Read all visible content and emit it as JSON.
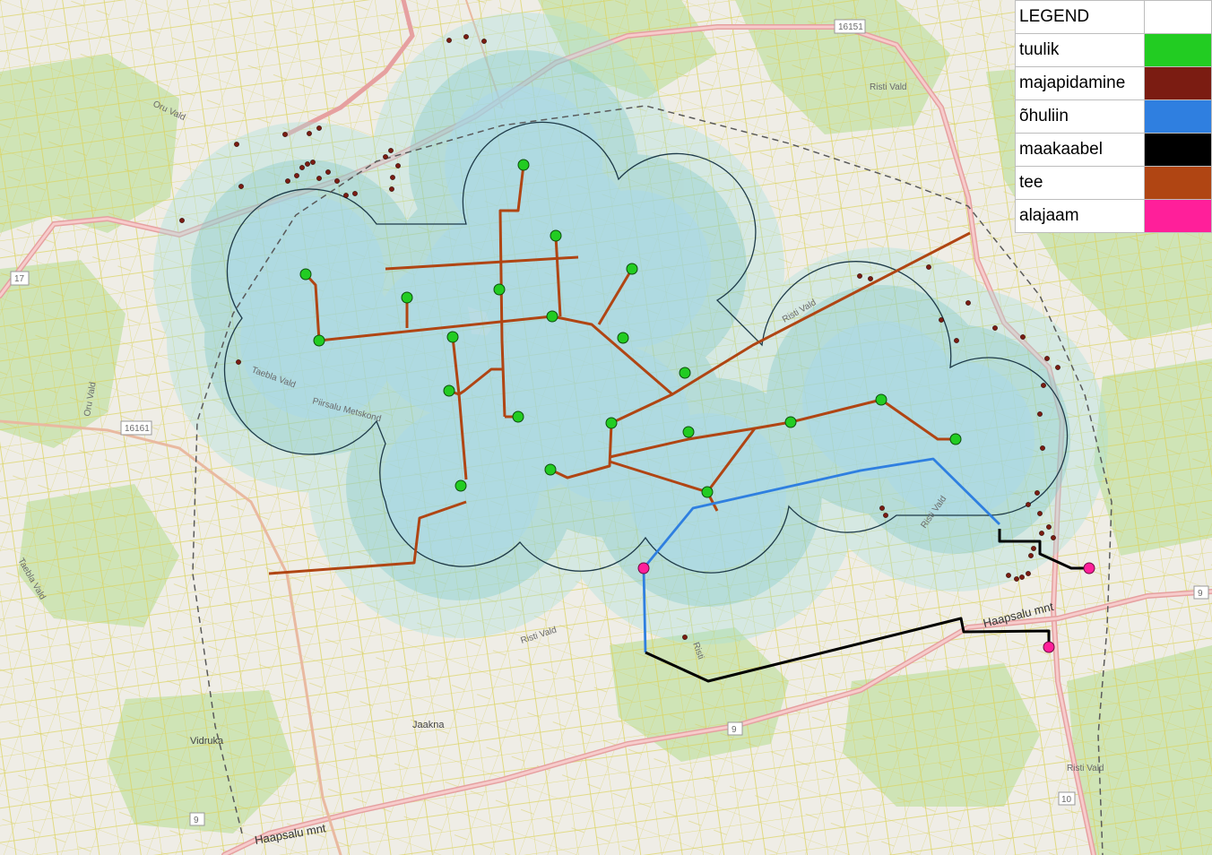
{
  "legend": {
    "title": "LEGEND",
    "items": [
      {
        "key": "tuulik",
        "label": "tuulik",
        "color": "#22cc22"
      },
      {
        "key": "majapidamine",
        "label": "majapidamine",
        "color": "#7b1c12"
      },
      {
        "key": "ohuliin",
        "label": "õhuliin",
        "color": "#2f7fe0"
      },
      {
        "key": "maakaabel",
        "label": "maakaabel",
        "color": "#000000"
      },
      {
        "key": "tee",
        "label": "tee",
        "color": "#b04513"
      },
      {
        "key": "alajaam",
        "label": "alajaam",
        "color": "#ff1f9a"
      }
    ]
  },
  "labels": {
    "r16151": "16151",
    "r17": "17",
    "r16161": "16161",
    "r9a": "9",
    "r9b": "9",
    "r9c": "9",
    "r10": "10",
    "risti_vald_top": "Risti Vald",
    "risti_vald_mid": "Risti Vald",
    "risti_vald_low": "Risti Vald",
    "risti_vald_bot": "Risti Vald",
    "risti_vald_right": "Risti Vald",
    "oru_vald_top": "Oru Vald",
    "oru_vald_left": "Oru Vald",
    "taebla_vald": "Taebla Vald",
    "taebla_vald_left": "Taebla Vald",
    "piirsalu_metskond": "Piirsalu Metskond",
    "haapsalu_mnt_right": "Haapsalu mnt",
    "haapsalu_mnt_left": "Haapsalu mnt",
    "jaakna": "Jaakna",
    "vidruka": "Vidruka",
    "risti": "Risti"
  },
  "turbines": [
    [
      584,
      184
    ],
    [
      620,
      263
    ],
    [
      341,
      306
    ],
    [
      454,
      332
    ],
    [
      557,
      323
    ],
    [
      705,
      300
    ],
    [
      616,
      353
    ],
    [
      356,
      380
    ],
    [
      505,
      376
    ],
    [
      695,
      377
    ],
    [
      764,
      416
    ],
    [
      501,
      436
    ],
    [
      578,
      465
    ],
    [
      682,
      472
    ],
    [
      983,
      446
    ],
    [
      882,
      471
    ],
    [
      768,
      482
    ],
    [
      1066,
      490
    ],
    [
      614,
      524
    ],
    [
      514,
      542
    ],
    [
      789,
      549
    ]
  ],
  "households": [
    [
      501,
      45
    ],
    [
      520,
      41
    ],
    [
      540,
      46
    ],
    [
      264,
      161
    ],
    [
      269,
      208
    ],
    [
      203,
      246
    ],
    [
      318,
      150
    ],
    [
      345,
      149
    ],
    [
      356,
      143
    ],
    [
      321,
      202
    ],
    [
      331,
      196
    ],
    [
      337,
      187
    ],
    [
      343,
      183
    ],
    [
      349,
      181
    ],
    [
      356,
      199
    ],
    [
      366,
      192
    ],
    [
      376,
      202
    ],
    [
      386,
      218
    ],
    [
      396,
      216
    ],
    [
      436,
      168
    ],
    [
      444,
      185
    ],
    [
      438,
      198
    ],
    [
      437,
      211
    ],
    [
      430,
      175
    ],
    [
      266,
      404
    ],
    [
      959,
      308
    ],
    [
      971,
      311
    ],
    [
      1036,
      298
    ],
    [
      1050,
      357
    ],
    [
      1067,
      380
    ],
    [
      1080,
      338
    ],
    [
      1110,
      366
    ],
    [
      1141,
      376
    ],
    [
      1168,
      400
    ],
    [
      1180,
      410
    ],
    [
      1164,
      430
    ],
    [
      1160,
      462
    ],
    [
      1163,
      500
    ],
    [
      1157,
      550
    ],
    [
      1147,
      563
    ],
    [
      1160,
      573
    ],
    [
      984,
      567
    ],
    [
      988,
      575
    ],
    [
      1125,
      642
    ],
    [
      1134,
      646
    ],
    [
      1140,
      644
    ],
    [
      1147,
      640
    ],
    [
      1150,
      620
    ],
    [
      1153,
      612
    ],
    [
      1162,
      595
    ],
    [
      1170,
      588
    ],
    [
      1175,
      600
    ],
    [
      764,
      711
    ]
  ],
  "substations": [
    [
      718,
      634
    ],
    [
      1215,
      634
    ],
    [
      1170,
      722
    ]
  ]
}
